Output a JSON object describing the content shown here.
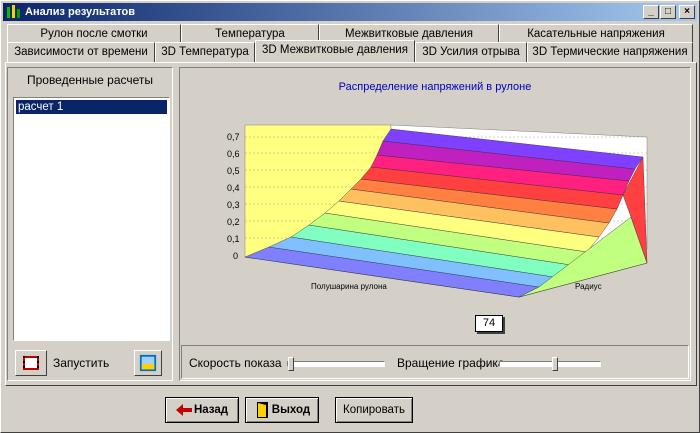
{
  "window": {
    "title": "Анализ результатов"
  },
  "tabs_row1": [
    {
      "label": "Рулон после смотки"
    },
    {
      "label": "Температура"
    },
    {
      "label": "Межвитковые давления"
    },
    {
      "label": "Касательные напряжения"
    }
  ],
  "tabs_row2": [
    {
      "label": "Зависимости от времени"
    },
    {
      "label": "3D Температура"
    },
    {
      "label": "3D Межвитковые давления"
    },
    {
      "label": "3D Усилия отрыва"
    },
    {
      "label": "3D Термические напряжения"
    }
  ],
  "left": {
    "title": "Проведенные расчеты",
    "items": [
      {
        "label": "расчет 1"
      }
    ],
    "run_label": "Запустить"
  },
  "chart": {
    "title": "Распределение напряжений в рулоне",
    "axis_x_label": "Полушарина рулона",
    "axis_y_label": "Радиус",
    "z_ticks": [
      "0",
      "0,1",
      "0,2",
      "0,3",
      "0,4",
      "0,5",
      "0,6",
      "0,7"
    ],
    "value_box": "74"
  },
  "controls": {
    "speed_label": "Скорость показа",
    "rotation_label": "Вращение графика",
    "speed_level": 0.0,
    "rotation_level": 0.55
  },
  "bottom": {
    "back_label": "Назад",
    "exit_label": "Выход",
    "copy_label": "Копировать"
  },
  "colors": {
    "titlebar_start": "#0a246a",
    "selection": "#0a246a",
    "chart_title": "#0000c0",
    "wall": "#ffff80"
  }
}
